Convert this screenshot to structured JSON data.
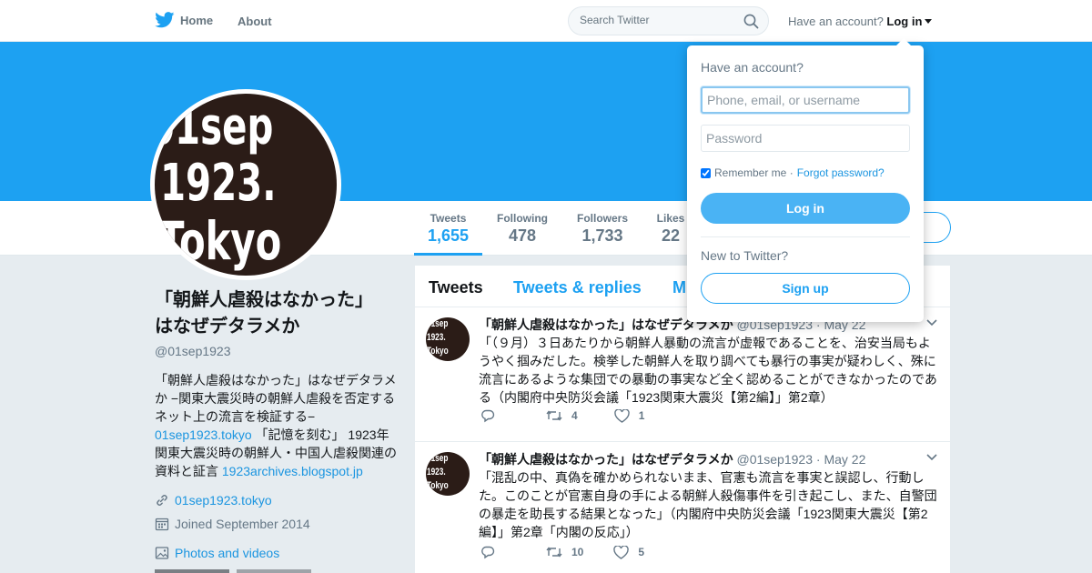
{
  "nav": {
    "home_label": "Home",
    "about_label": "About",
    "search_placeholder": "Search Twitter",
    "have_account": "Have an account?",
    "login_label": "Log in",
    "brand_color": "#1da1f2"
  },
  "avatar": {
    "lines": [
      "01sep",
      "1923.",
      "Tokyo"
    ]
  },
  "stats": [
    {
      "label": "Tweets",
      "value": "1,655",
      "active": true
    },
    {
      "label": "Following",
      "value": "478",
      "active": false
    },
    {
      "label": "Followers",
      "value": "1,733",
      "active": false
    },
    {
      "label": "Likes",
      "value": "22",
      "active": false
    }
  ],
  "profile": {
    "name_line1": "「朝鮮人虐殺はなかった」",
    "name_line2": "はなぜデタラメか",
    "handle": "@01sep1923",
    "bio_part1": "「朝鮮人虐殺はなかった」はなぜデタラメか −関東大震災時の朝鮮人虐殺を否定するネット上の流言を検証する−",
    "bio_link1": "01sep1923.tokyo",
    "bio_part2": " 「記憶を刻む」 1923年関東大震災時の朝鮮人・中国人虐殺関連の資料と証言 ",
    "bio_link2": "1923archives.blogspot.jp",
    "website": "01sep1923.tokyo",
    "joined": "Joined September 2014",
    "photos_label": "Photos and videos"
  },
  "tabs": {
    "tweets": "Tweets",
    "replies": "Tweets & replies",
    "media_partial": "M"
  },
  "tweets": [
    {
      "name": "「朝鮮人虐殺はなかった」はなぜデタラメか",
      "handle": "@01sep1923",
      "date": "· May 22",
      "text": "「（９月）３日あたりから朝鮮人暴動の流言が虚報であることを、治安当局もようやく掴みだした。検挙した朝鮮人を取り調べても暴行の事実が疑わしく、殊に流言にあるような集団での暴動の事実など全く認めることができなかったのである（内閣府中央防災会議「1923関東大震災【第2編】」第2章）",
      "retweets": "4",
      "likes": "1"
    },
    {
      "name": "「朝鮮人虐殺はなかった」はなぜデタラメか",
      "handle": "@01sep1923",
      "date": "· May 22",
      "text": "「混乱の中、真偽を確かめられないまま、官憲も流言を事実と誤認し、行動した。このことが官憲自身の手による朝鮮人殺傷事件を引き起こし、また、自警団の暴走を助長する結果となった」（内閣府中央防災会議「1923関東大震災【第2編】」第2章「内閣の反応」）",
      "retweets": "10",
      "likes": "5"
    }
  ],
  "login_dropdown": {
    "title": "Have an account?",
    "username_placeholder": "Phone, email, or username",
    "password_placeholder": "Password",
    "remember_label": "Remember me ·",
    "forgot_label": "Forgot password?",
    "login_button": "Log in",
    "new_label": "New to Twitter?",
    "signup_button": "Sign up"
  }
}
